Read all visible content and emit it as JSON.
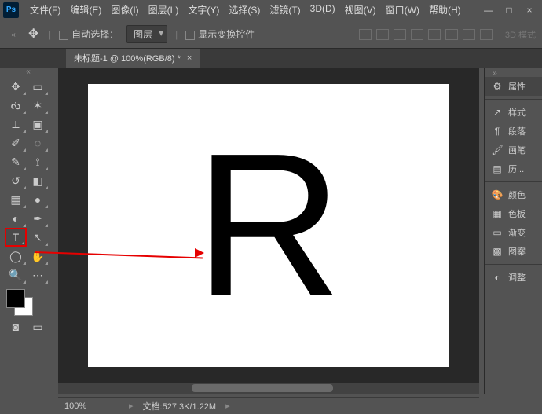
{
  "app": {
    "logo": "Ps"
  },
  "menu": [
    "文件(F)",
    "编辑(E)",
    "图像(I)",
    "图层(L)",
    "文字(Y)",
    "选择(S)",
    "滤镜(T)",
    "3D(D)",
    "视图(V)",
    "窗口(W)",
    "帮助(H)"
  ],
  "window_controls": {
    "min": "—",
    "max": "□",
    "close": "×"
  },
  "options": {
    "auto_select_label": "自动选择：",
    "layer_dd": "图层",
    "show_transform": "显示变换控件",
    "mode3d": "3D 模式"
  },
  "tab": {
    "title": "未标题-1 @ 100%(RGB/8) *",
    "close": "×"
  },
  "tools": {
    "items": [
      {
        "n": "move-tool",
        "g": "✥"
      },
      {
        "n": "marquee-tool",
        "g": "▭"
      },
      {
        "n": "lasso-tool",
        "g": "ᔔ"
      },
      {
        "n": "wand-tool",
        "g": "✶"
      },
      {
        "n": "crop-tool",
        "g": "⟂"
      },
      {
        "n": "frame-tool",
        "g": "▣"
      },
      {
        "n": "eyedropper-tool",
        "g": "✐"
      },
      {
        "n": "patch-tool",
        "g": "◌"
      },
      {
        "n": "brush-tool",
        "g": "✎"
      },
      {
        "n": "stamp-tool",
        "g": "⟟"
      },
      {
        "n": "history-brush-tool",
        "g": "↺"
      },
      {
        "n": "eraser-tool",
        "g": "◧"
      },
      {
        "n": "gradient-tool",
        "g": "▦"
      },
      {
        "n": "blur-tool",
        "g": "●"
      },
      {
        "n": "dodge-tool",
        "g": "◐"
      },
      {
        "n": "pen-tool",
        "g": "✒"
      },
      {
        "n": "type-tool",
        "g": "T",
        "sel": true
      },
      {
        "n": "path-select-tool",
        "g": "↖"
      },
      {
        "n": "shape-tool",
        "g": "◯"
      },
      {
        "n": "hand-tool",
        "g": "✋"
      },
      {
        "n": "zoom-tool",
        "g": "🔍"
      },
      {
        "n": "edit-toolbar",
        "g": "⋯"
      }
    ]
  },
  "canvas": {
    "glyph": "R"
  },
  "right_panels": {
    "header": {
      "icon": "⚙",
      "label": "属性"
    },
    "groups": [
      [
        {
          "icon": "↗",
          "label": "样式"
        },
        {
          "icon": "¶",
          "label": "段落"
        },
        {
          "icon": "🖌",
          "label": "画笔"
        },
        {
          "icon": "▤",
          "label": "历..."
        }
      ],
      [
        {
          "icon": "🎨",
          "label": "颜色"
        },
        {
          "icon": "▦",
          "label": "色板"
        },
        {
          "icon": "▭",
          "label": "渐变"
        },
        {
          "icon": "▩",
          "label": "图案"
        }
      ],
      [
        {
          "icon": "◐",
          "label": "调整"
        }
      ]
    ]
  },
  "status": {
    "zoom": "100%",
    "doc_label": "文档:",
    "doc_value": "527.3K/1.22M",
    "chev": "▸"
  }
}
